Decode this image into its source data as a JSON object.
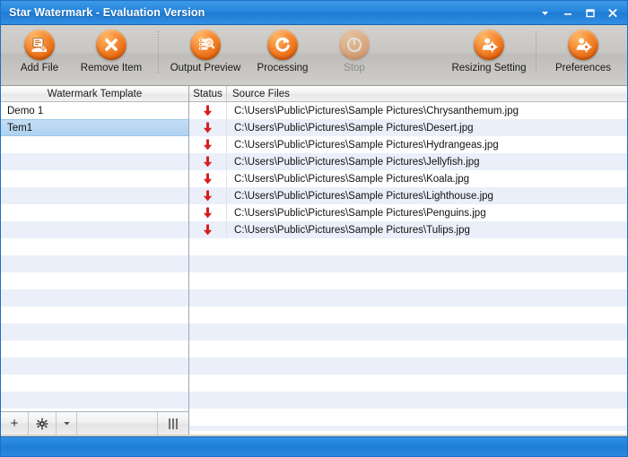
{
  "window": {
    "title": "Star Watermark - Evaluation Version",
    "controls": [
      {
        "name": "dropdown-menu-button",
        "glyph": "chevron-down-icon"
      },
      {
        "name": "minimize-button",
        "glyph": "minimize-icon"
      },
      {
        "name": "maximize-button",
        "glyph": "maximize-icon"
      },
      {
        "name": "close-button",
        "glyph": "close-icon"
      }
    ]
  },
  "toolbar": {
    "items": [
      {
        "label": "Add File",
        "icon": "add-file-icon",
        "enabled": true
      },
      {
        "label": "Remove Item",
        "icon": "remove-item-icon",
        "enabled": true
      },
      {
        "label": "Output Preview",
        "icon": "output-preview-icon",
        "enabled": true
      },
      {
        "label": "Processing",
        "icon": "processing-icon",
        "enabled": true
      },
      {
        "label": "Stop",
        "icon": "stop-icon",
        "enabled": false
      },
      {
        "label": "Resizing Setting",
        "icon": "resizing-setting-icon",
        "enabled": true
      },
      {
        "label": "Preferences",
        "icon": "preferences-icon",
        "enabled": true
      }
    ]
  },
  "template_panel": {
    "header": "Watermark Template",
    "items": [
      {
        "label": "Demo 1",
        "selected": false
      },
      {
        "label": "Tem1",
        "selected": true
      }
    ],
    "footer": {
      "add_button": "+",
      "settings_button": "gear-icon",
      "dropdown_button": "caret-down-icon",
      "resize_grip": "resize-grip-icon"
    }
  },
  "file_panel": {
    "headers": {
      "status": "Status",
      "source_files": "Source Files"
    },
    "rows": [
      {
        "status": "pending-down-arrow",
        "path": "C:\\Users\\Public\\Pictures\\Sample Pictures\\Chrysanthemum.jpg"
      },
      {
        "status": "pending-down-arrow",
        "path": "C:\\Users\\Public\\Pictures\\Sample Pictures\\Desert.jpg"
      },
      {
        "status": "pending-down-arrow",
        "path": "C:\\Users\\Public\\Pictures\\Sample Pictures\\Hydrangeas.jpg"
      },
      {
        "status": "pending-down-arrow",
        "path": "C:\\Users\\Public\\Pictures\\Sample Pictures\\Jellyfish.jpg"
      },
      {
        "status": "pending-down-arrow",
        "path": "C:\\Users\\Public\\Pictures\\Sample Pictures\\Koala.jpg"
      },
      {
        "status": "pending-down-arrow",
        "path": "C:\\Users\\Public\\Pictures\\Sample Pictures\\Lighthouse.jpg"
      },
      {
        "status": "pending-down-arrow",
        "path": "C:\\Users\\Public\\Pictures\\Sample Pictures\\Penguins.jpg"
      },
      {
        "status": "pending-down-arrow",
        "path": "C:\\Users\\Public\\Pictures\\Sample Pictures\\Tulips.jpg"
      }
    ]
  },
  "statusbar": {
    "text": ""
  },
  "colors": {
    "titlebar_blue": "#2484dc",
    "statusbar_blue": "#1f7fd6",
    "icon_orange": "#e8690f",
    "selection_blue": "#aed2f0",
    "stripe_blue": "#eaeff9",
    "status_arrow_red": "#d61f1f"
  }
}
